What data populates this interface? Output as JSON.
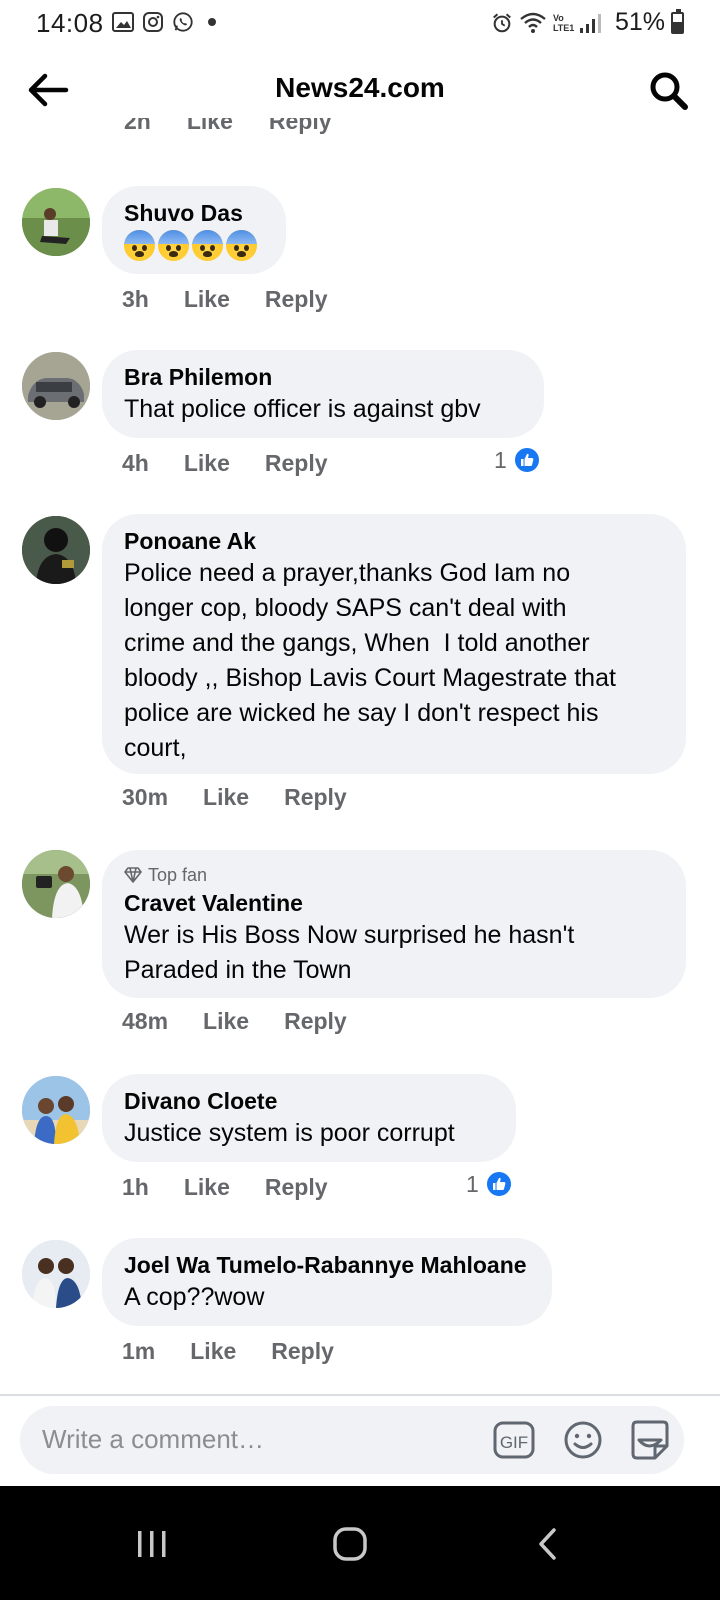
{
  "status_bar": {
    "time": "14:08",
    "battery": "51%",
    "battery_level": 0.51,
    "network_label": "Vo LTE1"
  },
  "header": {
    "title": "News24.com"
  },
  "top_actions": {
    "time": "2h",
    "like": "Like",
    "reply": "Reply"
  },
  "comments": [
    {
      "author": "Shuvo Das",
      "text": "",
      "emoji": [
        "anxious-face-with-sweat",
        "anxious-face-with-sweat",
        "anxious-face-with-sweat",
        "anxious-face-with-sweat"
      ],
      "time": "3h",
      "like": "Like",
      "reply": "Reply"
    },
    {
      "author": "Bra Philemon",
      "text": "That police officer is against gbv",
      "time": "4h",
      "like": "Like",
      "reply": "Reply",
      "reaction_count": "1"
    },
    {
      "author": "Ponoane Ak",
      "text_lines": [
        "Police need a prayer,thanks God Iam no",
        "longer cop, bloody SAPS can't deal with",
        "crime and the gangs, When  I told another",
        "bloody ,, Bishop Lavis Court Magestrate that",
        "police are wicked he say I don't respect his",
        "court,"
      ],
      "time": "30m",
      "like": "Like",
      "reply": "Reply"
    },
    {
      "badge": "Top fan",
      "author": "Cravet Valentine",
      "text_lines": [
        "Wer is His Boss Now surprised he hasn't",
        "Paraded in the Town"
      ],
      "time": "48m",
      "like": "Like",
      "reply": "Reply"
    },
    {
      "author": "Divano Cloete",
      "text": "Justice system is poor corrupt",
      "time": "1h",
      "like": "Like",
      "reply": "Reply",
      "reaction_count": "1"
    },
    {
      "author": "Joel Wa Tumelo-Rabannye Mahloane",
      "text": "A cop??wow",
      "time": "1m",
      "like": "Like",
      "reply": "Reply"
    }
  ],
  "composer": {
    "placeholder": "Write a comment…",
    "gif_label": "GIF"
  },
  "colors": {
    "bubble": "#f0f2f5",
    "secondary_text": "#65676b",
    "like_blue": "#1877f2"
  }
}
